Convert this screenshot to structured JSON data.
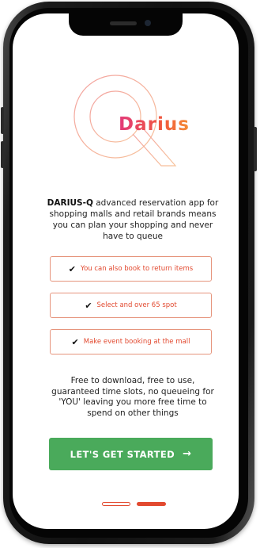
{
  "brand": {
    "logo_text": "Darius",
    "accent_color": "#e2492f",
    "cta_color": "#4aaa5b"
  },
  "intro": {
    "brand_name": "DARIUS-Q",
    "text": " advanced reservation app for shopping malls and retail brands means you can plan your shopping and never have to queue"
  },
  "features": [
    {
      "label": "You can also book to return items",
      "icon": "check-icon"
    },
    {
      "label": "Select and over 65 spot",
      "icon": "check-icon"
    },
    {
      "label": "Make event booking at the mall",
      "icon": "check-icon"
    }
  ],
  "outro": {
    "text": "Free to download, free to use, guaranteed time slots, no queueing for 'YOU' leaving you more free time to spend on other things"
  },
  "cta": {
    "label": "LET'S GET STARTED",
    "icon": "arrow-right-icon"
  },
  "pagination": {
    "total": 2,
    "active": 2
  }
}
